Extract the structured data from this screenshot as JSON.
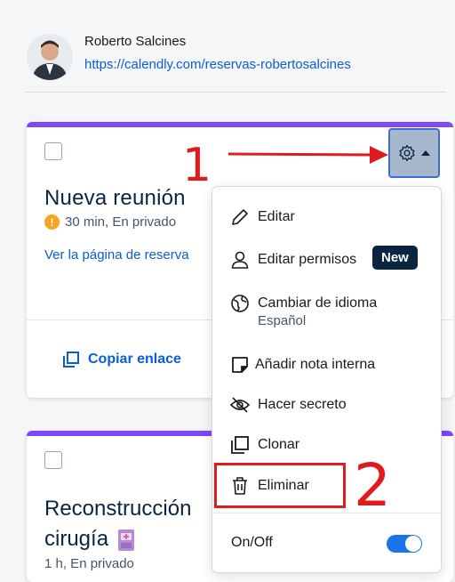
{
  "profile": {
    "name": "Roberto Salcines",
    "url": "https://calendly.com/reservas-robertosalcines"
  },
  "card1": {
    "title": "Nueva reunión",
    "meta": "30 min, En privado",
    "link": "Ver la página de reserva",
    "copy_label": "Copiar enlace"
  },
  "card2": {
    "title_line1": "Reconstrucción",
    "title_line2": "cirugía",
    "meta": "1 h, En privado"
  },
  "menu": {
    "items": [
      {
        "label": "Editar",
        "icon": "pencil-icon"
      },
      {
        "label": "Editar permisos",
        "icon": "person-icon",
        "badge": "New"
      },
      {
        "label": "Cambiar de idioma",
        "icon": "globe-icon",
        "sub": "Español"
      },
      {
        "label": "Añadir nota interna",
        "icon": "note-icon"
      },
      {
        "label": "Hacer secreto",
        "icon": "eye-off-icon"
      },
      {
        "label": "Clonar",
        "icon": "clone-icon"
      },
      {
        "label": "Eliminar",
        "icon": "trash-icon"
      }
    ],
    "toggle_label": "On/Off",
    "toggle_on": true
  },
  "annotations": {
    "step1": "1",
    "step2": "2",
    "color": "#e01b1b"
  },
  "colors": {
    "accent": "#8247f5",
    "link": "#0b5cd6",
    "toggle": "#1a73e8"
  }
}
